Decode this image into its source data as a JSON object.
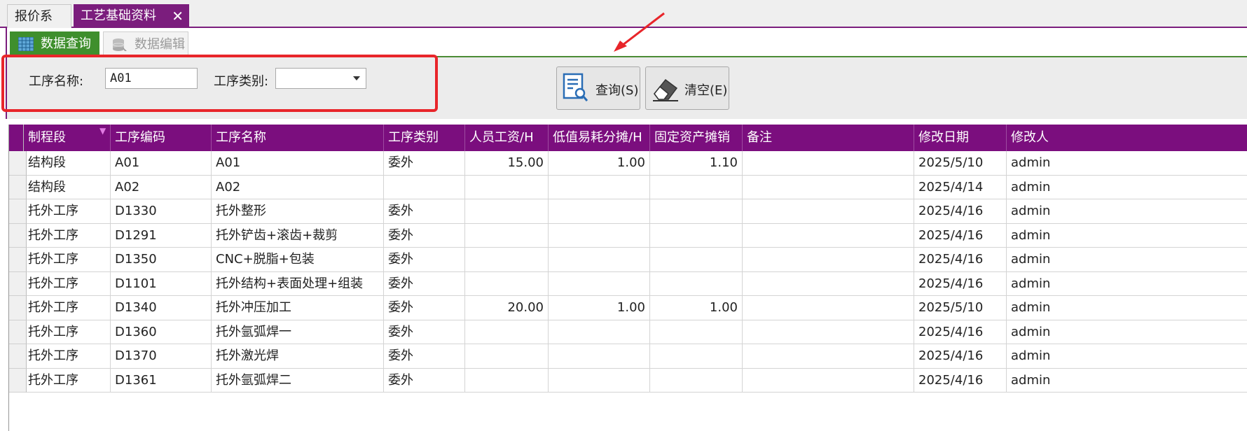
{
  "top_tabs": [
    {
      "label": "报价系统",
      "active": false
    },
    {
      "label": "工艺基础资料",
      "active": true
    }
  ],
  "close_symbol": "✕",
  "sub_tabs": [
    {
      "label": "数据查询",
      "active": true,
      "icon": "grid-icon"
    },
    {
      "label": "数据编辑",
      "active": false,
      "icon": "database-icon"
    }
  ],
  "query": {
    "process_name_label": "工序名称:",
    "process_name_value": "A01",
    "process_type_label": "工序类别:",
    "process_type_value": "",
    "search_button": "查询(S)",
    "clear_button": "清空(E)"
  },
  "colors": {
    "accent": "#7b0e7e",
    "highlight": "#e8252a",
    "tab_green": "#3f8f2d"
  },
  "table": {
    "columns": [
      "制程段",
      "工序编码",
      "工序名称",
      "工序类别",
      "人员工资/H",
      "低值易耗分摊/H",
      "固定资产摊销",
      "备注",
      "修改日期",
      "修改人"
    ],
    "rows": [
      [
        "结构段",
        "A01",
        "A01",
        "委外",
        "15.00",
        "1.00",
        "1.10",
        "",
        "2025/5/10",
        "admin"
      ],
      [
        "结构段",
        "A02",
        "A02",
        "",
        "",
        "",
        "",
        "",
        "2025/4/14",
        "admin"
      ],
      [
        "托外工序",
        "D1330",
        "托外整形",
        "委外",
        "",
        "",
        "",
        "",
        "2025/4/16",
        "admin"
      ],
      [
        "托外工序",
        "D1291",
        "托外铲齿+滚齿+裁剪",
        "委外",
        "",
        "",
        "",
        "",
        "2025/4/16",
        "admin"
      ],
      [
        "托外工序",
        "D1350",
        "CNC+脱脂+包装",
        "委外",
        "",
        "",
        "",
        "",
        "2025/4/16",
        "admin"
      ],
      [
        "托外工序",
        "D1101",
        "托外结构+表面处理+组装",
        "委外",
        "",
        "",
        "",
        "",
        "2025/4/16",
        "admin"
      ],
      [
        "托外工序",
        "D1340",
        "托外冲压加工",
        "委外",
        "20.00",
        "1.00",
        "1.00",
        "",
        "2025/5/10",
        "admin"
      ],
      [
        "托外工序",
        "D1360",
        "托外氩弧焊一",
        "委外",
        "",
        "",
        "",
        "",
        "2025/4/16",
        "admin"
      ],
      [
        "托外工序",
        "D1370",
        "托外激光焊",
        "委外",
        "",
        "",
        "",
        "",
        "2025/4/16",
        "admin"
      ],
      [
        "托外工序",
        "D1361",
        "托外氩弧焊二",
        "委外",
        "",
        "",
        "",
        "",
        "2025/4/16",
        "admin"
      ]
    ]
  }
}
